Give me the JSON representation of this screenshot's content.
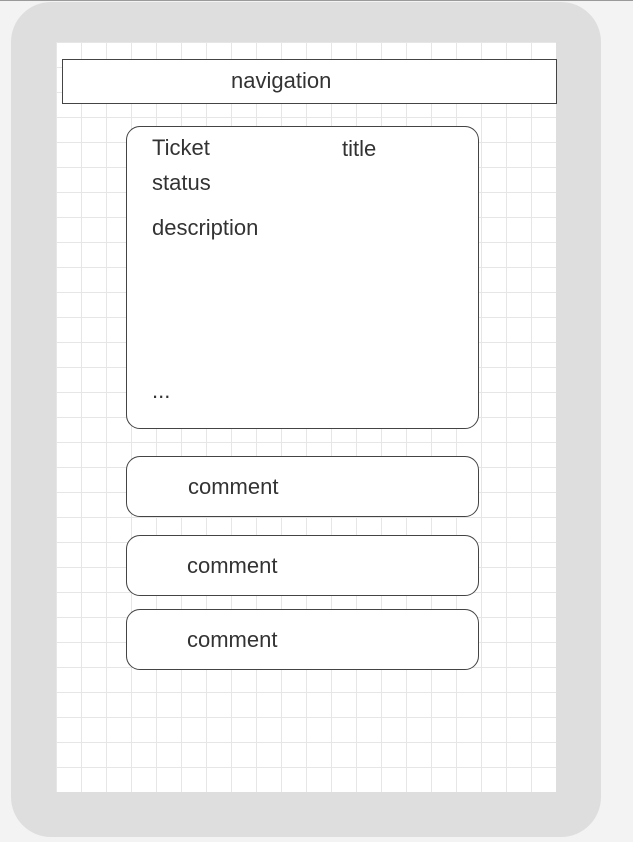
{
  "navigation": {
    "label": "navigation"
  },
  "ticket": {
    "label": "Ticket",
    "title": "title",
    "status": "status",
    "description": "description",
    "more": "..."
  },
  "comments": [
    {
      "label": "comment"
    },
    {
      "label": "comment"
    },
    {
      "label": "comment"
    }
  ],
  "colors": {
    "frame": "#dedede",
    "screen": "#ffffff",
    "grid_minor": "#e6e6e6",
    "grid_major": "#d4d4d4",
    "border": "#444444",
    "text": "#333333"
  }
}
